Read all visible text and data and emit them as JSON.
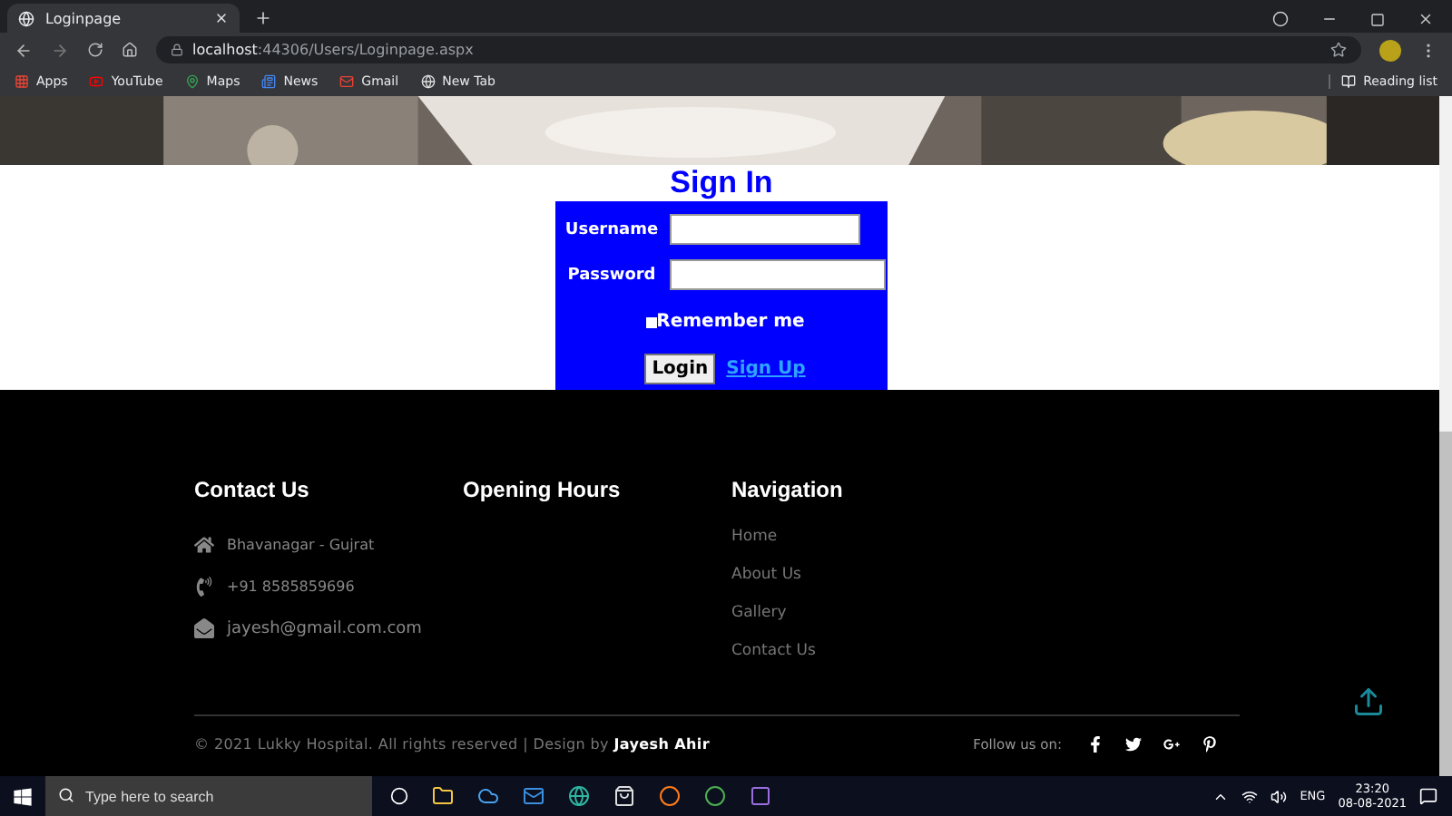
{
  "browser": {
    "tab_title": "Loginpage",
    "url_host": "localhost",
    "url_path": ":44306/Users/Loginpage.aspx",
    "bookmarks": [
      {
        "kind": "apps",
        "label": "Apps"
      },
      {
        "kind": "youtube",
        "label": "YouTube"
      },
      {
        "kind": "maps",
        "label": "Maps"
      },
      {
        "kind": "news",
        "label": "News"
      },
      {
        "kind": "gmail",
        "label": "Gmail"
      },
      {
        "kind": "newtab",
        "label": "New Tab"
      }
    ],
    "reading_list": "Reading list"
  },
  "login": {
    "title": "Sign In",
    "fields": [
      {
        "label": "Username"
      },
      {
        "label": "Password"
      }
    ],
    "remember": {
      "label": "Remember me",
      "checked": false
    },
    "button": "Login",
    "link": "Sign Up"
  },
  "footer": {
    "contact": {
      "heading": "Contact Us",
      "items": [
        {
          "kind": "home",
          "text": "Bhavanagar - Gujrat"
        },
        {
          "kind": "phone",
          "text": "+91 8585859696"
        },
        {
          "kind": "mail",
          "text": "jayesh@gmail.com.com"
        }
      ]
    },
    "opening_hours": {
      "heading": "Opening Hours"
    },
    "navigation": {
      "heading": "Navigation",
      "links": [
        "Home",
        "About Us",
        "Gallery",
        "Contact Us"
      ]
    },
    "copyright": "© 2021 Lukky Hospital. All rights reserved | Design by **Jayesh Ahir**",
    "follow_label": "Follow us on:",
    "socials": [
      {
        "kind": "facebook"
      },
      {
        "kind": "twitter"
      },
      {
        "kind": "googleplus"
      },
      {
        "kind": "pinterest"
      }
    ]
  },
  "taskbar": {
    "search_placeholder": "Type here to search",
    "language": "ENG",
    "time": "23:20",
    "date": "08-08-2021"
  }
}
